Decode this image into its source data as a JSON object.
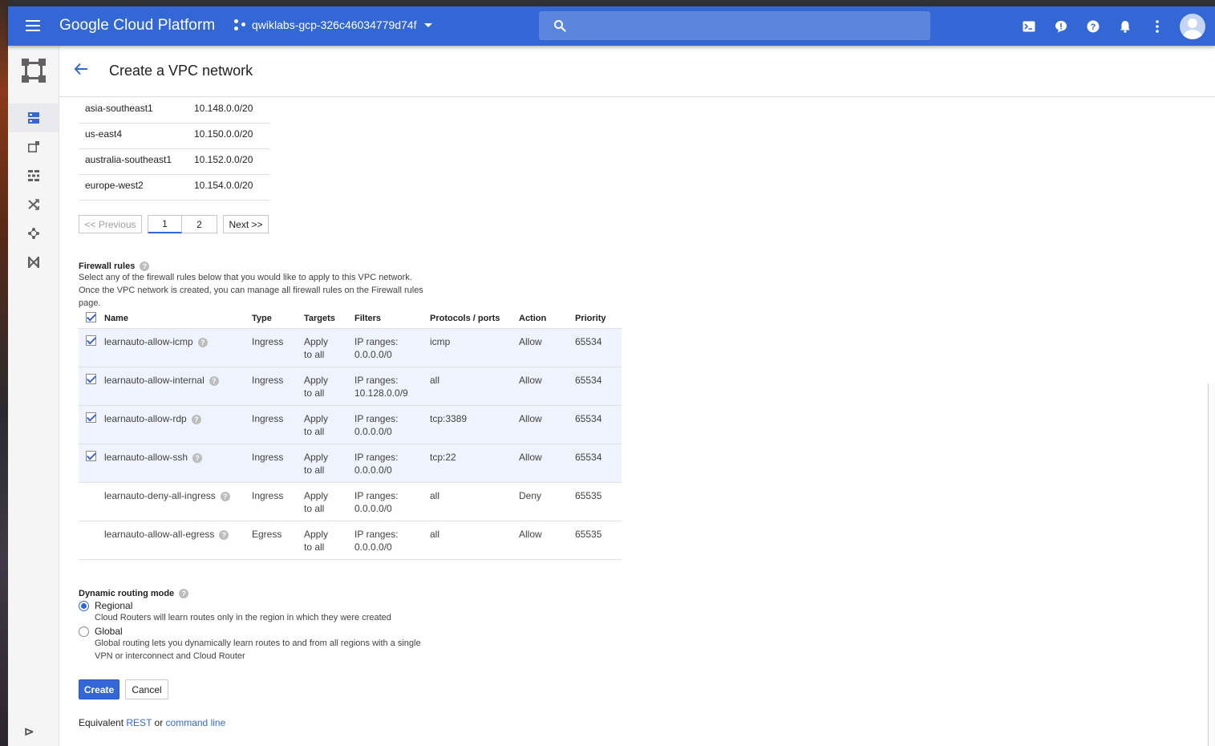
{
  "header": {
    "brand": "Google Cloud Platform",
    "project": "qwiklabs-gcp-326c46034779d74f",
    "search_placeholder": "",
    "icons": [
      "cloud-shell-icon",
      "feedback-icon",
      "help-icon",
      "notifications-icon",
      "more-vert-icon",
      "account-avatar-icon"
    ]
  },
  "sidenav": {
    "items": [
      "vpc-networks-icon",
      "external-ip-icon",
      "firewall-rules-icon",
      "routes-icon",
      "vpc-peering-icon",
      "shared-vpc-icon"
    ]
  },
  "page": {
    "title": "Create a VPC network"
  },
  "subnets": [
    {
      "region": "asia-southeast1",
      "ip": "10.148.0.0/20"
    },
    {
      "region": "us-east4",
      "ip": "10.150.0.0/20"
    },
    {
      "region": "australia-southeast1",
      "ip": "10.152.0.0/20"
    },
    {
      "region": "europe-west2",
      "ip": "10.154.0.0/20"
    }
  ],
  "pager": {
    "previous": "<< Previous",
    "page1": "1",
    "page2": "2",
    "next": "Next >>"
  },
  "firewall": {
    "label": "Firewall rules",
    "description_1": "Select any of the firewall rules below that you would like to apply to this VPC network.",
    "description_2": "Once the VPC network is created, you can manage all firewall rules on the Firewall rules",
    "description_3": "page.",
    "columns": {
      "name": "Name",
      "type": "Type",
      "targets": "Targets",
      "filters": "Filters",
      "protocols": "Protocols / ports",
      "action": "Action",
      "priority": "Priority"
    },
    "rows": [
      {
        "checked": true,
        "name": "learnauto-allow-icmp",
        "type": "Ingress",
        "targets_1": "Apply",
        "targets_2": "to all",
        "filters_1": "IP ranges:",
        "filters_2": "0.0.0.0/0",
        "protocols": "icmp",
        "action": "Allow",
        "priority": "65534"
      },
      {
        "checked": true,
        "name": "learnauto-allow-internal",
        "type": "Ingress",
        "targets_1": "Apply",
        "targets_2": "to all",
        "filters_1": "IP ranges:",
        "filters_2": "10.128.0.0/9",
        "protocols": "all",
        "action": "Allow",
        "priority": "65534"
      },
      {
        "checked": true,
        "name": "learnauto-allow-rdp",
        "type": "Ingress",
        "targets_1": "Apply",
        "targets_2": "to all",
        "filters_1": "IP ranges:",
        "filters_2": "0.0.0.0/0",
        "protocols": "tcp:3389",
        "action": "Allow",
        "priority": "65534"
      },
      {
        "checked": true,
        "name": "learnauto-allow-ssh",
        "type": "Ingress",
        "targets_1": "Apply",
        "targets_2": "to all",
        "filters_1": "IP ranges:",
        "filters_2": "0.0.0.0/0",
        "protocols": "tcp:22",
        "action": "Allow",
        "priority": "65534"
      },
      {
        "checked": false,
        "name": "learnauto-deny-all-ingress",
        "type": "Ingress",
        "targets_1": "Apply",
        "targets_2": "to all",
        "filters_1": "IP ranges:",
        "filters_2": "0.0.0.0/0",
        "protocols": "all",
        "action": "Deny",
        "priority": "65535"
      },
      {
        "checked": false,
        "name": "learnauto-allow-all-egress",
        "type": "Egress",
        "targets_1": "Apply",
        "targets_2": "to all",
        "filters_1": "IP ranges:",
        "filters_2": "0.0.0.0/0",
        "protocols": "all",
        "action": "Allow",
        "priority": "65535"
      }
    ]
  },
  "routing": {
    "label": "Dynamic routing mode",
    "selected": "Regional",
    "regional_label": "Regional",
    "regional_desc": "Cloud Routers will learn routes only in the region in which they were created",
    "global_label": "Global",
    "global_desc_1": "Global routing lets you dynamically learn routes to and from all regions with a single",
    "global_desc_2": "VPN or interconnect and Cloud Router"
  },
  "actions": {
    "create": "Create",
    "cancel": "Cancel"
  },
  "equivalent": {
    "prefix": "Equivalent",
    "rest": "REST",
    "or": "or",
    "command_line": "command line"
  },
  "colors": {
    "brand_blue": "#3367d6",
    "selected_row": "#eef3fd"
  }
}
